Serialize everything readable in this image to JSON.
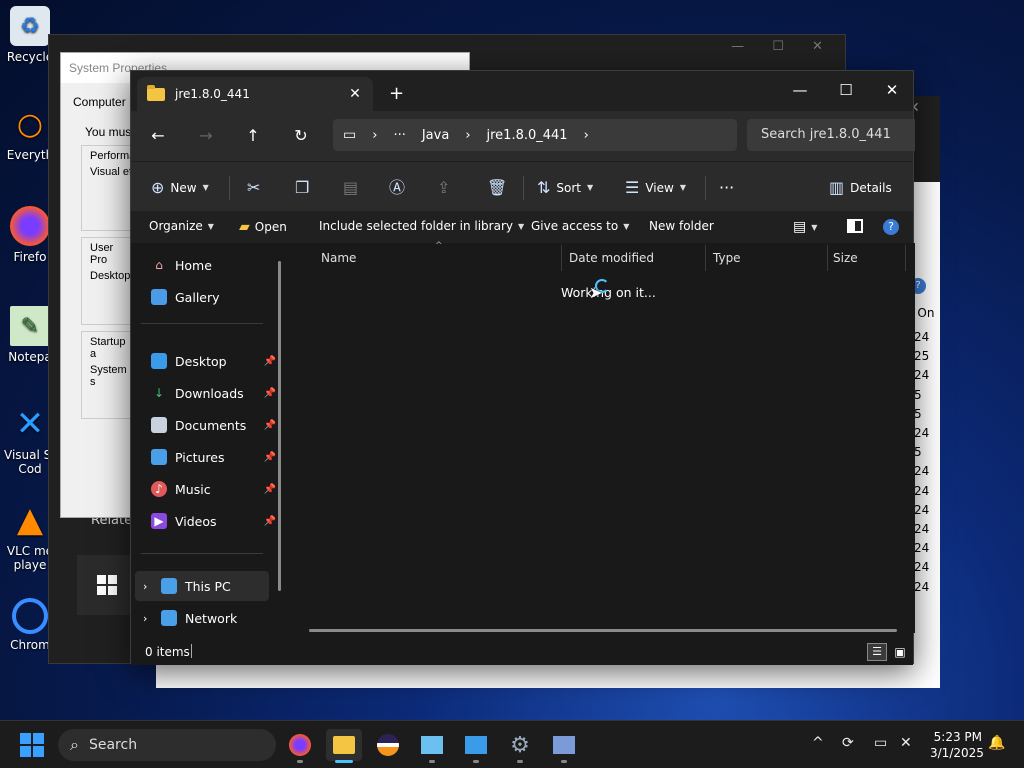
{
  "desktop": {
    "icons": [
      {
        "label": "Recycle",
        "icon": "recycle-bin-icon"
      },
      {
        "label": "Everyth",
        "icon": "everything-search-icon"
      },
      {
        "label": "Firefo",
        "icon": "firefox-icon"
      },
      {
        "label": "Notepa",
        "icon": "notepad-icon"
      },
      {
        "label": "Visual St",
        "label2": "Cod",
        "icon": "vscode-icon"
      },
      {
        "label": "VLC me",
        "label2": "playe",
        "icon": "vlc-icon"
      },
      {
        "label": "Chrom",
        "icon": "chrome-icon"
      }
    ]
  },
  "system_properties": {
    "title": "System Properties",
    "tab": "Computer N",
    "you_must": "You must",
    "perf": "Performa",
    "visual": "Visual ef",
    "user_prof": "User Pro",
    "desktop": "Desktop",
    "startup": "Startup a",
    "system": "System s",
    "related": "Relate"
  },
  "bg_right_window": {
    "header": "d On",
    "dates": [
      "24",
      "25",
      "24",
      "5",
      "5",
      "24",
      "5",
      "24",
      "24",
      "24",
      "24",
      "24",
      "24",
      "24"
    ]
  },
  "explorer": {
    "tab_title": "jre1.8.0_441",
    "address": {
      "overflow": "···",
      "crumbs": [
        "Java",
        "jre1.8.0_441"
      ]
    },
    "search_placeholder": "Search jre1.8.0_441",
    "commands": {
      "new": "New",
      "sort": "Sort",
      "view": "View",
      "more": "···",
      "details": "Details"
    },
    "bar2": {
      "organize": "Organize",
      "open": "Open",
      "include": "Include selected folder in library",
      "give_access": "Give access to",
      "new_folder": "New folder"
    },
    "sidebar": {
      "home": "Home",
      "gallery": "Gallery",
      "desktop": "Desktop",
      "downloads": "Downloads",
      "documents": "Documents",
      "pictures": "Pictures",
      "music": "Music",
      "videos": "Videos",
      "this_pc": "This PC",
      "network": "Network"
    },
    "columns": {
      "name": "Name",
      "date_modified": "Date modified",
      "type": "Type",
      "size": "Size"
    },
    "working": "Working on it...",
    "status": "0 items"
  },
  "taskbar": {
    "search": "Search",
    "time": "5:23 PM",
    "date": "3/1/2025"
  },
  "colors": {
    "accent": "#4cc2ff",
    "folder": "#f4c542",
    "help": "#3a7bd5"
  }
}
